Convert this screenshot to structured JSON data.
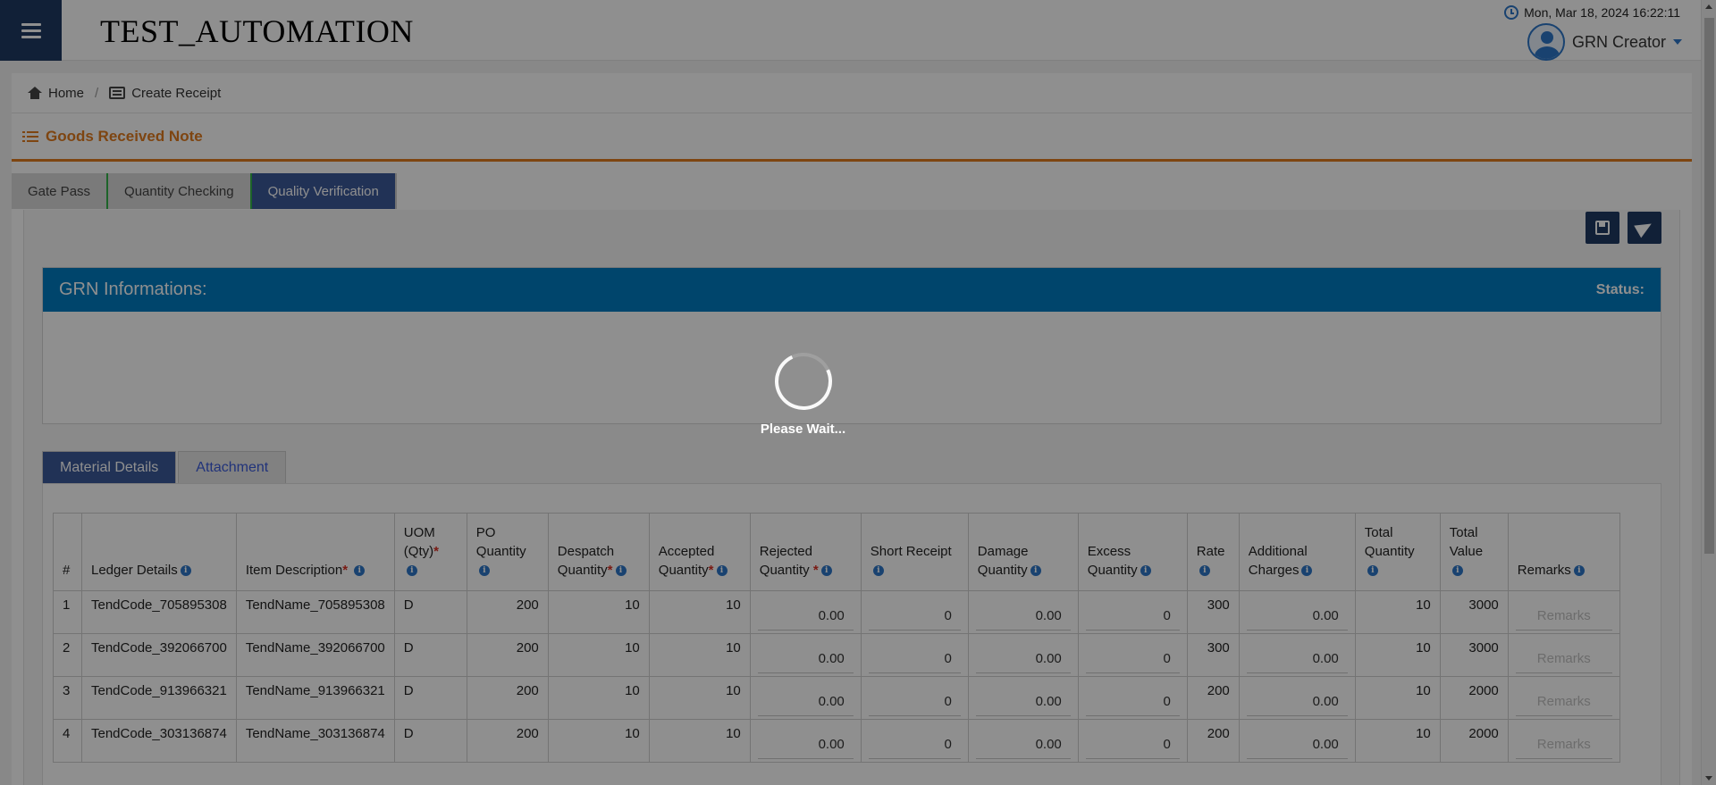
{
  "app": {
    "title": "TEST_AUTOMATION",
    "datetime": "Mon, Mar 18, 2024 16:22:11",
    "user": "GRN Creator"
  },
  "breadcrumb": {
    "home": "Home",
    "current": "Create Receipt"
  },
  "section_title": "Goods Received Note",
  "tabs": [
    "Gate Pass",
    "Quantity Checking",
    "Quality Verification"
  ],
  "grn": {
    "title": "GRN Informations:",
    "status_label": "Status:"
  },
  "material_tabs": [
    "Material Details",
    "Attachment"
  ],
  "loading_text": "Please Wait...",
  "table": {
    "headers": {
      "num": "#",
      "ledger": "Ledger Details",
      "item": "Item Description",
      "uom": "UOM (Qty)",
      "po_qty": "PO Quantity",
      "despatch": "Despatch Quantity",
      "accepted": "Accepted Quantity",
      "rejected": "Rejected Quantity",
      "short": "Short Receipt",
      "damage": "Damage Quantity",
      "excess": "Excess Quantity",
      "rate": "Rate",
      "additional": "Additional Charges",
      "total_qty": "Total Quantity",
      "total_value": "Total Value",
      "remarks": "Remarks"
    },
    "remarks_placeholder": "Remarks",
    "rows": [
      {
        "num": "1",
        "ledger": "TendCode_705895308",
        "item": "TendName_705895308",
        "uom": "D",
        "po_qty": "200",
        "despatch": "10",
        "accepted": "10",
        "rejected": "0.00",
        "short": "0",
        "damage": "0.00",
        "excess": "0",
        "rate": "300",
        "additional": "0.00",
        "total_qty": "10",
        "total_value": "3000"
      },
      {
        "num": "2",
        "ledger": "TendCode_392066700",
        "item": "TendName_392066700",
        "uom": "D",
        "po_qty": "200",
        "despatch": "10",
        "accepted": "10",
        "rejected": "0.00",
        "short": "0",
        "damage": "0.00",
        "excess": "0",
        "rate": "300",
        "additional": "0.00",
        "total_qty": "10",
        "total_value": "3000"
      },
      {
        "num": "3",
        "ledger": "TendCode_913966321",
        "item": "TendName_913966321",
        "uom": "D",
        "po_qty": "200",
        "despatch": "10",
        "accepted": "10",
        "rejected": "0.00",
        "short": "0",
        "damage": "0.00",
        "excess": "0",
        "rate": "200",
        "additional": "0.00",
        "total_qty": "10",
        "total_value": "2000"
      },
      {
        "num": "4",
        "ledger": "TendCode_303136874",
        "item": "TendName_303136874",
        "uom": "D",
        "po_qty": "200",
        "despatch": "10",
        "accepted": "10",
        "rejected": "0.00",
        "short": "0",
        "damage": "0.00",
        "excess": "0",
        "rate": "200",
        "additional": "0.00",
        "total_qty": "10",
        "total_value": "2000"
      }
    ]
  }
}
